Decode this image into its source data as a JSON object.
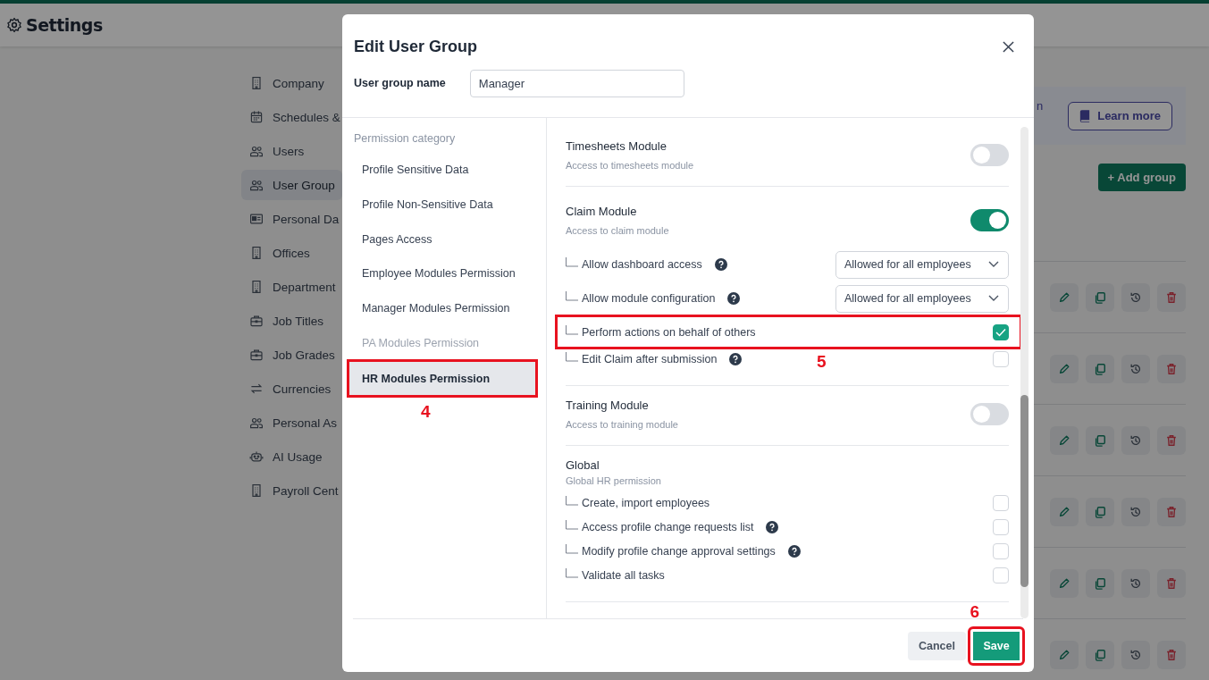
{
  "page": {
    "title": "Settings"
  },
  "nav": [
    {
      "label": "Company",
      "kind": "building",
      "selected": false
    },
    {
      "label": "Schedules &",
      "kind": "calendar",
      "selected": false
    },
    {
      "label": "Users",
      "kind": "people",
      "selected": false
    },
    {
      "label": "User Group",
      "kind": "people",
      "selected": true
    },
    {
      "label": "Personal Da",
      "kind": "card",
      "selected": false
    },
    {
      "label": "Offices",
      "kind": "building",
      "selected": false
    },
    {
      "label": "Department",
      "kind": "building",
      "selected": false
    },
    {
      "label": "Job Titles",
      "kind": "briefcase",
      "selected": false
    },
    {
      "label": "Job Grades",
      "kind": "briefcase",
      "selected": false
    },
    {
      "label": "Currencies",
      "kind": "arrows",
      "selected": false
    },
    {
      "label": "Personal As",
      "kind": "people",
      "selected": false
    },
    {
      "label": "AI Usage",
      "kind": "robot",
      "selected": false
    },
    {
      "label": "Payroll Cent",
      "kind": "building",
      "selected": false
    }
  ],
  "banner": {
    "text": "n",
    "button": "Learn more"
  },
  "add_button": "+ Add group",
  "dialog": {
    "title": "Edit User Group",
    "name_label": "User group name",
    "name_value": "Manager",
    "category_heading": "Permission category",
    "categories": [
      {
        "label": "Profile Sensitive Data",
        "selected": false,
        "disabled": false,
        "highlighted": false
      },
      {
        "label": "Profile Non-Sensitive Data",
        "selected": false,
        "disabled": false,
        "highlighted": false
      },
      {
        "label": "Pages Access",
        "selected": false,
        "disabled": false,
        "highlighted": false
      },
      {
        "label": "Employee Modules Permission",
        "selected": false,
        "disabled": false,
        "highlighted": false
      },
      {
        "label": "Manager Modules Permission",
        "selected": false,
        "disabled": false,
        "highlighted": false
      },
      {
        "label": "PA Modules Permission",
        "selected": false,
        "disabled": true,
        "highlighted": false
      },
      {
        "label": "HR Modules Permission",
        "selected": true,
        "disabled": false,
        "highlighted": true,
        "callout": "4"
      }
    ],
    "modules": [
      {
        "kind": "toggle",
        "title": "Timesheets Module",
        "description": "Access to timesheets module",
        "on": false
      },
      {
        "kind": "toggle",
        "title": "Claim Module",
        "description": "Access to claim module",
        "on": true,
        "items": [
          {
            "kind": "select",
            "label": "Allow dashboard access",
            "help": true,
            "value": "Allowed for all employees",
            "highlighted": false
          },
          {
            "kind": "select",
            "label": "Allow module configuration",
            "help": true,
            "value": "Allowed for all employees",
            "highlighted": false
          },
          {
            "kind": "checkbox",
            "label": "Perform actions on behalf of others",
            "help": false,
            "checked": true,
            "highlighted": true,
            "callout": "5"
          },
          {
            "kind": "checkbox",
            "label": "Edit Claim after submission",
            "help": true,
            "checked": false,
            "highlighted": false
          }
        ]
      },
      {
        "kind": "toggle",
        "title": "Training Module",
        "description": "Access to training module",
        "on": false
      },
      {
        "kind": "plain",
        "title": "Global",
        "description": "Global HR permission",
        "items": [
          {
            "kind": "checkbox",
            "label": "Create, import employees",
            "help": false,
            "checked": false,
            "highlighted": false
          },
          {
            "kind": "checkbox",
            "label": "Access profile change requests list",
            "help": true,
            "checked": false,
            "highlighted": false
          },
          {
            "kind": "checkbox",
            "label": "Modify profile change approval settings",
            "help": true,
            "checked": false,
            "highlighted": false
          },
          {
            "kind": "checkbox",
            "label": "Validate all tasks",
            "help": false,
            "checked": false,
            "highlighted": false
          }
        ]
      }
    ],
    "cancel": "Cancel",
    "save": {
      "label": "Save",
      "highlighted": true,
      "callout": "6"
    }
  }
}
